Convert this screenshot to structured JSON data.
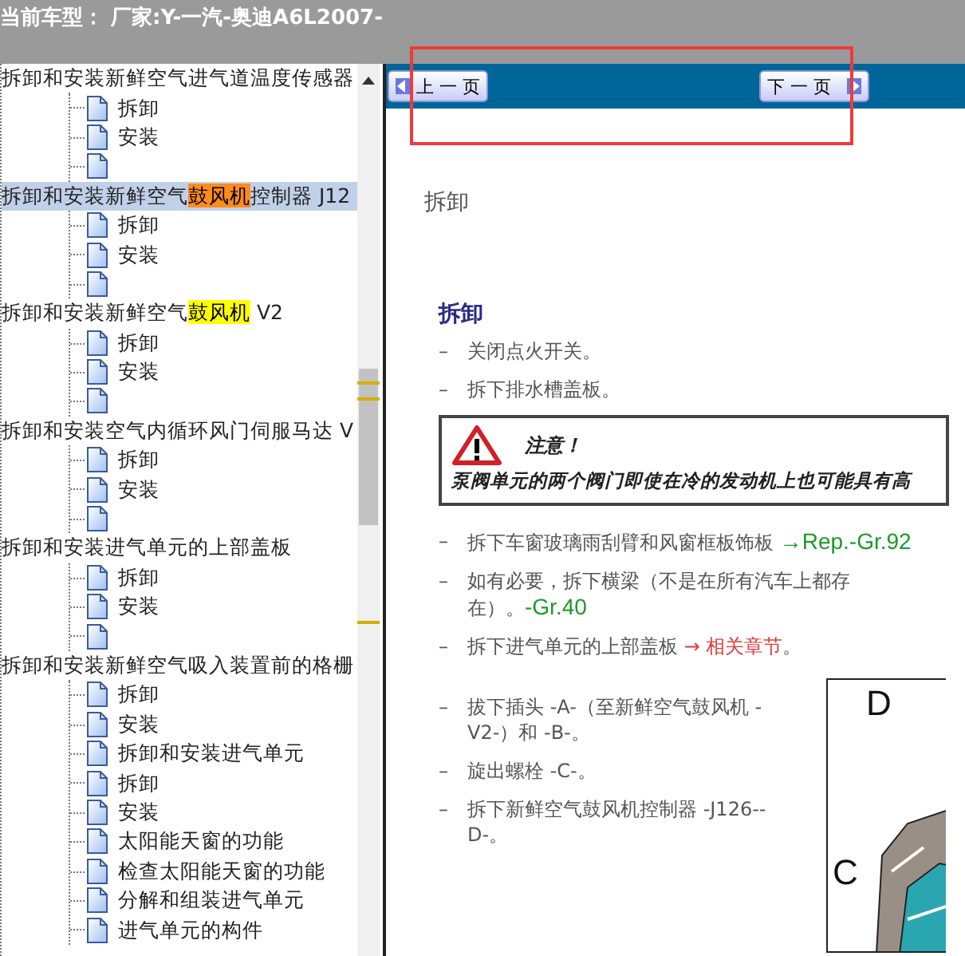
{
  "header": {
    "title": "当前车型： 厂家:Y-一汽-奥迪A6L2007-"
  },
  "tree": [
    {
      "parts": [
        {
          "text": "拆卸和安装新鲜空气进气道温度传感器"
        }
      ],
      "selected": false,
      "children": [
        {
          "label": "拆卸"
        },
        {
          "label": "安装"
        },
        {
          "kind": "page"
        }
      ]
    },
    {
      "parts": [
        {
          "text": "拆卸和安装新鲜空气"
        },
        {
          "text": "鼓风机",
          "color": "#ff8c1a"
        },
        {
          "text": "控制器 J12"
        }
      ],
      "selected": true,
      "children": [
        {
          "label": "拆卸"
        },
        {
          "label": "安装"
        },
        {
          "kind": "page"
        }
      ]
    },
    {
      "parts": [
        {
          "text": "拆卸和安装新鲜空气"
        },
        {
          "text": "鼓风机",
          "color": "#ffff00"
        },
        {
          "text": " V2"
        }
      ],
      "selected": false,
      "children": [
        {
          "label": "拆卸"
        },
        {
          "label": "安装"
        },
        {
          "kind": "page"
        }
      ]
    },
    {
      "parts": [
        {
          "text": "拆卸和安装空气内循环风门伺服马达 V"
        }
      ],
      "selected": false,
      "children": [
        {
          "label": "拆卸"
        },
        {
          "label": "安装"
        },
        {
          "kind": "page"
        }
      ]
    },
    {
      "parts": [
        {
          "text": "拆卸和安装进气单元的上部盖板"
        }
      ],
      "selected": false,
      "children": [
        {
          "label": "拆卸"
        },
        {
          "label": "安装"
        },
        {
          "kind": "page"
        }
      ]
    },
    {
      "parts": [
        {
          "text": "拆卸和安装新鲜空气吸入装置前的格栅"
        }
      ],
      "selected": false,
      "children": [
        {
          "label": "拆卸"
        },
        {
          "label": "安装"
        },
        {
          "label": "拆卸和安装进气单元"
        },
        {
          "label": "拆卸"
        },
        {
          "label": "安装"
        },
        {
          "label": "太阳能天窗的功能"
        },
        {
          "label": "检查太阳能天窗的功能"
        },
        {
          "label": "分解和组装进气单元"
        },
        {
          "label": "进气单元的构件"
        }
      ]
    }
  ],
  "nav": {
    "prev": "上 一 页",
    "next": "下 一 页"
  },
  "document": {
    "section": "拆卸",
    "heading": "拆卸",
    "steps": [
      {
        "kind": "step",
        "bullet": "–",
        "parts": [
          {
            "text": "关闭点火开关。"
          }
        ]
      },
      {
        "kind": "step",
        "bullet": "–",
        "parts": [
          {
            "text": "拆下排水槽盖板。"
          }
        ]
      },
      {
        "kind": "warning",
        "title": "注意！",
        "text": "泵阀单元的两个阀门即使在冷的发动机上也可能具有高"
      },
      {
        "kind": "step",
        "bullet": "–",
        "parts": [
          {
            "text": "拆下车窗玻璃雨刮臂和风窗框板饰板 "
          },
          {
            "text": "→Rep.-Gr.92",
            "kind": "link"
          }
        ]
      },
      {
        "kind": "step",
        "bullet": "–",
        "parts": [
          {
            "text": "如有必要，拆下横梁（不是在所有汽车上都存在）。"
          },
          {
            "text": "-Gr.40",
            "kind": "link"
          }
        ]
      },
      {
        "kind": "step",
        "bullet": "–",
        "parts": [
          {
            "text": "拆下进气单元的上部盖板 "
          },
          {
            "text": "→ 相关章节",
            "kind": "ref"
          },
          {
            "text": "。"
          }
        ]
      }
    ],
    "steps_beside_figure": [
      {
        "kind": "step",
        "bullet": "–",
        "parts": [
          {
            "text": "拔下插头 -A-（至新鲜空气鼓风机 -V2-）和 -B-。"
          }
        ]
      },
      {
        "kind": "step",
        "bullet": "–",
        "parts": [
          {
            "text": "旋出螺栓 -C-。"
          }
        ]
      },
      {
        "kind": "step",
        "bullet": "–",
        "parts": [
          {
            "text": "拆下新鲜空气鼓风机控制器 -J126--D-。"
          }
        ]
      }
    ],
    "figure": {
      "labels": [
        "D",
        "C"
      ]
    }
  }
}
